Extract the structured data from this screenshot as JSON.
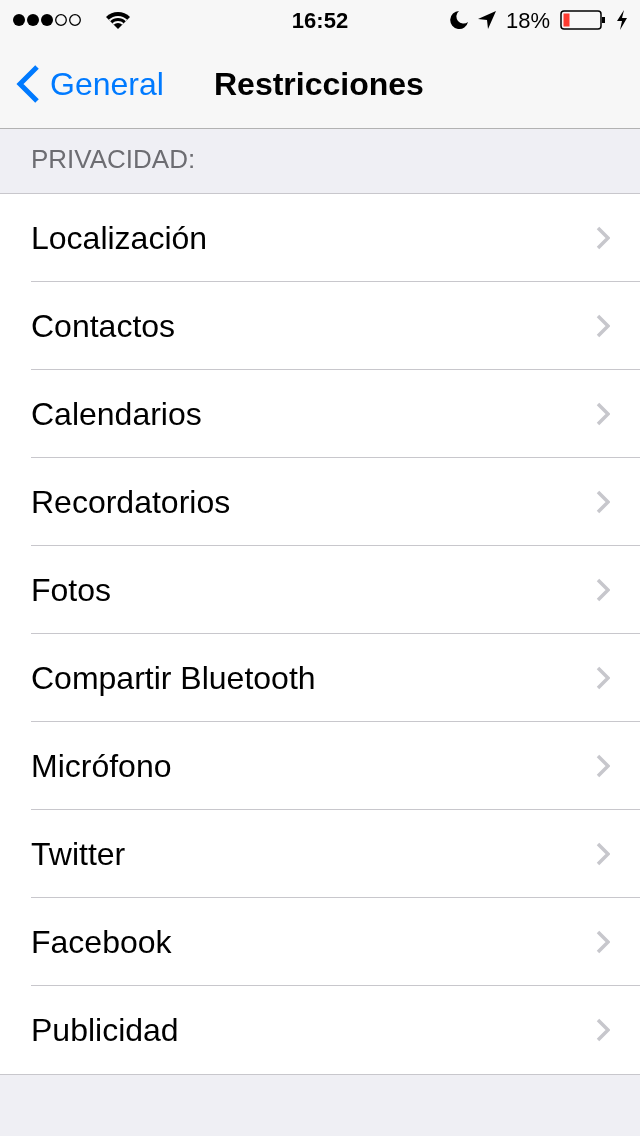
{
  "status_bar": {
    "time": "16:52",
    "battery": "18%"
  },
  "nav_bar": {
    "back": "General",
    "title": "Restricciones"
  },
  "section": {
    "header": "PRIVACIDAD:"
  },
  "items": [
    {
      "label": "Localización"
    },
    {
      "label": "Contactos"
    },
    {
      "label": "Calendarios"
    },
    {
      "label": "Recordatorios"
    },
    {
      "label": "Fotos"
    },
    {
      "label": "Compartir Bluetooth"
    },
    {
      "label": "Micrófono"
    },
    {
      "label": "Twitter"
    },
    {
      "label": "Facebook"
    },
    {
      "label": "Publicidad"
    }
  ]
}
